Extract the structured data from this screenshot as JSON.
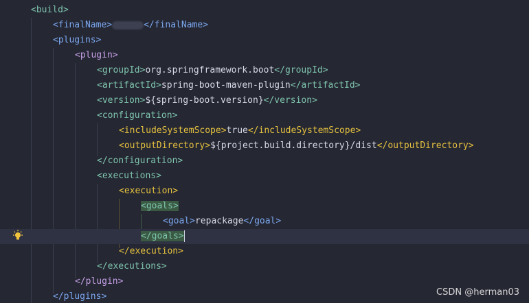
{
  "editor": {
    "lines": [
      {
        "open": "<build>",
        "text": "",
        "close": ""
      },
      {
        "open": "<finalName>",
        "text": "",
        "redacted": true,
        "close": "</finalName>"
      },
      {
        "open": "<plugins>",
        "text": "",
        "close": ""
      },
      {
        "open": "<plugin>",
        "text": "",
        "close": ""
      },
      {
        "open": "<groupId>",
        "text": "org.springframework.boot",
        "close": "</groupId>"
      },
      {
        "open": "<artifactId>",
        "text": "spring-boot-maven-plugin",
        "close": "</artifactId>"
      },
      {
        "open": "<version>",
        "text": "${spring-boot.version}",
        "close": "</version>"
      },
      {
        "open": "<configuration>",
        "text": "",
        "close": ""
      },
      {
        "open": "<includeSystemScope>",
        "text": "true",
        "close": "</includeSystemScope>"
      },
      {
        "open": "<outputDirectory>",
        "text": "${project.build.directory}/dist",
        "close": "</outputDirectory>"
      },
      {
        "open": "</configuration>",
        "text": "",
        "close": ""
      },
      {
        "open": "<executions>",
        "text": "",
        "close": ""
      },
      {
        "open": "<execution>",
        "text": "",
        "close": ""
      },
      {
        "open": "<goals>",
        "text": "",
        "close": ""
      },
      {
        "open": "<goal>",
        "text": "repackage",
        "close": "</goal>"
      },
      {
        "open": "</goals>",
        "text": "",
        "close": ""
      },
      {
        "open": "</execution>",
        "text": "",
        "close": ""
      },
      {
        "open": "</executions>",
        "text": "",
        "close": ""
      },
      {
        "open": "</plugin>",
        "text": "",
        "close": ""
      },
      {
        "open": "</plugins>",
        "text": "",
        "close": ""
      }
    ],
    "intention_icon": "lightbulb-icon"
  },
  "watermark": "CSDN @herman03",
  "colors": {
    "background": "#252733",
    "current_line": "#2f3242",
    "tag_green": "#7fc5ad",
    "tag_yellow": "#e6c23f",
    "tag_blue": "#7ca8ef",
    "tag_purple": "#c5a0e6",
    "text": "#d6d9e6",
    "match_highlight": "#3a5a44"
  }
}
